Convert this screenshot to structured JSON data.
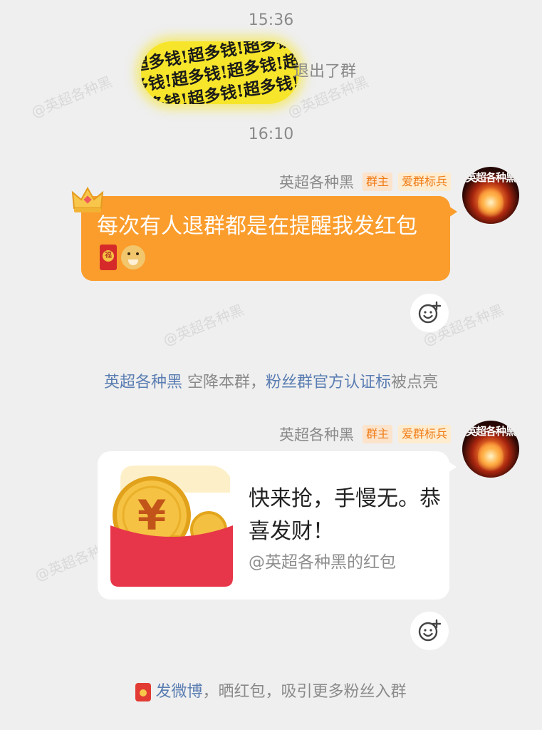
{
  "watermark": "@英超各种黑",
  "times": {
    "first": "15:36",
    "second": "16:10"
  },
  "leave_notice": {
    "sticker_lines": [
      "超多钱!超多钱!超多钱!",
      "多钱!超多钱!超多钱!超",
      "超多钱!超多钱!超多钱!"
    ],
    "text": "退出了群"
  },
  "message1": {
    "sender": "英超各种黑",
    "badges": [
      "群主",
      "爱群标兵"
    ],
    "text": "每次有人退群都是在提醒我发红包"
  },
  "avatar_caption": "英超各种黑",
  "system_notice": {
    "user": "英超各种黑",
    "action": " 空降本群，",
    "link": "粉丝群官方认证标",
    "suffix": "被点亮"
  },
  "message2": {
    "sender": "英超各种黑",
    "badges": [
      "群主",
      "爱群标兵"
    ],
    "card_title": "快来抢，手慢无。恭喜发财！",
    "card_sub": "@英超各种黑的红包"
  },
  "bottom_tip": {
    "link": "发微博",
    "text": "，晒红包，吸引更多粉丝入群"
  },
  "colors": {
    "orange_bubble": "#fb9d2c",
    "link": "#5a7db2",
    "badge": "#f07a13",
    "background": "#efefef"
  },
  "icons": [
    "crown-icon",
    "red-packet-icon",
    "doge-emoji-icon",
    "add-reaction-icon"
  ]
}
